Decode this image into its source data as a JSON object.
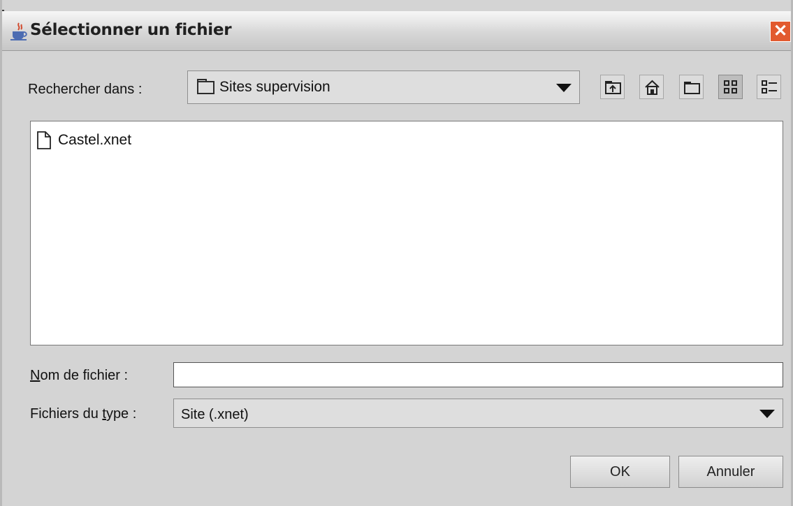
{
  "window": {
    "title": "Sélectionner un fichier",
    "close_symbol": "✕"
  },
  "look_in": {
    "label_prefix": "Rechercher dans :",
    "value": "Sites supervision"
  },
  "toolbar": {
    "icons": [
      "up-folder-icon",
      "home-icon",
      "new-folder-icon",
      "list-view-icon",
      "details-view-icon"
    ]
  },
  "files": [
    {
      "name": "Castel.xnet",
      "icon": "document-icon"
    }
  ],
  "filename": {
    "label": "Nom de fichier :",
    "mnemonic": "N",
    "rest": "om de fichier :",
    "value": ""
  },
  "filetype": {
    "label": "Fichiers du type :",
    "pre": "Fichiers du ",
    "mnemonic": "t",
    "post": "ype :",
    "value": "Site (.xnet)"
  },
  "buttons": {
    "ok": "OK",
    "cancel": "Annuler"
  },
  "colors": {
    "dialog_bg": "#d4d4d4",
    "close_button": "#e25a2f",
    "list_bg": "#ffffff"
  }
}
